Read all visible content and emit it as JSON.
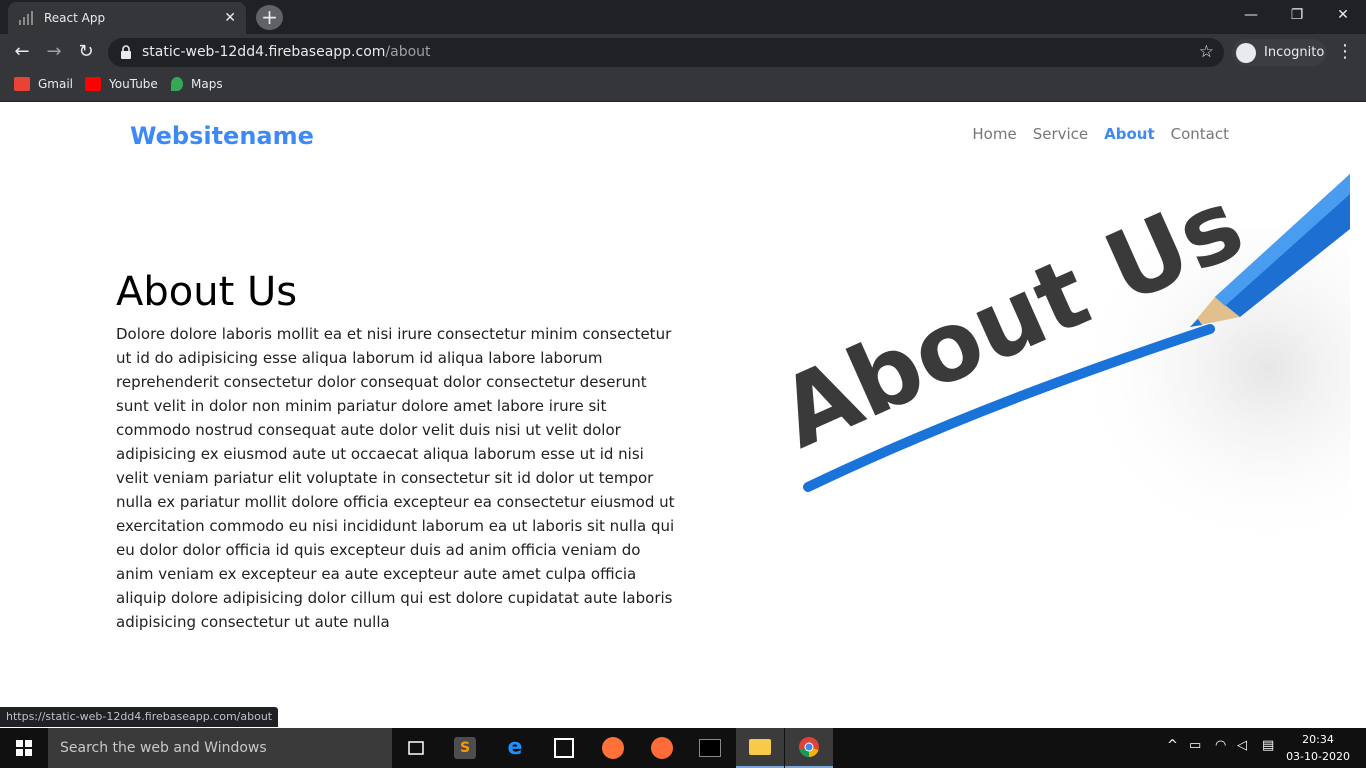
{
  "browser": {
    "tab_title": "React App",
    "tab_close": "✕",
    "new_tab": "+",
    "url_host": "static-web-12dd4.firebaseapp.com",
    "url_path": "/about",
    "incognito_label": "Incognito",
    "bookmarks": [
      {
        "label": "Gmail",
        "icon": "gmail-icon",
        "color": "#ea4335"
      },
      {
        "label": "YouTube",
        "icon": "youtube-icon",
        "color": "#ff0000"
      },
      {
        "label": "Maps",
        "icon": "maps-icon",
        "color": "#34a853"
      }
    ],
    "status_url": "https://static-web-12dd4.firebaseapp.com/about"
  },
  "site": {
    "brand": "Websitename",
    "nav": [
      {
        "label": "Home",
        "active": false
      },
      {
        "label": "Service",
        "active": false
      },
      {
        "label": "About",
        "active": true
      },
      {
        "label": "Contact",
        "active": false
      }
    ],
    "about_title": "About Us",
    "about_body": "Dolore dolore laboris mollit ea et nisi irure consectetur minim consectetur ut id do adipisicing esse aliqua laborum id aliqua labore laborum reprehenderit consectetur dolor consequat dolor consectetur deserunt sunt velit in dolor non minim pariatur dolore amet labore irure sit commodo nostrud consequat aute dolor velit duis nisi ut velit dolor adipisicing ex eiusmod aute ut occaecat aliqua laborum esse ut id nisi velit veniam pariatur elit voluptate in consectetur sit id dolor ut tempor nulla ex pariatur mollit dolore officia excepteur ea consectetur eiusmod ut exercitation commodo eu nisi incididunt laborum ea ut laboris sit nulla qui eu dolor dolor officia id quis excepteur duis ad anim officia veniam do anim veniam ex excepteur ea aute excepteur aute amet culpa officia aliquip dolore adipisicing dolor cillum qui est dolore cupidatat aute laboris adipisicing consectetur ut aute nulla",
    "hero_image_text": "About Us",
    "accent_color": "#3d8af7"
  },
  "taskbar": {
    "search_placeholder": "Search the web and Windows",
    "time": "20:34",
    "date": "03-10-2020"
  }
}
